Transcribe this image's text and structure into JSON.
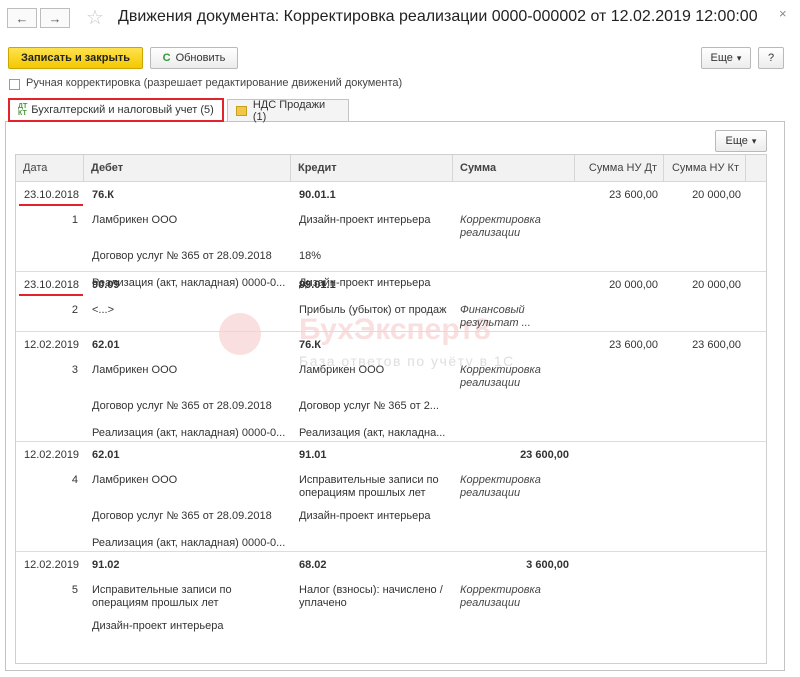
{
  "window": {
    "title": "Движения документа: Корректировка реализации 0000-000002 от 12.02.2019 12:00:00",
    "back_glyph": "←",
    "forward_glyph": "→",
    "star_glyph": "☆",
    "close_glyph": "×"
  },
  "toolbar": {
    "save_close_label": "Записать и закрыть",
    "refresh_label": "Обновить",
    "refresh_glyph": "C",
    "more_label": "Еще",
    "help_label": "?"
  },
  "manual_correction": {
    "label": "Ручная корректировка (разрешает редактирование движений документа)",
    "checked": false
  },
  "tabs": [
    {
      "label": "Бухгалтерский и налоговый учет (5)",
      "icon_top": "ДТ",
      "icon_bottom": "КТ",
      "active": true
    },
    {
      "label": "НДС Продажи (1)",
      "active": false
    }
  ],
  "grid_more_label": "Еще",
  "dropdown_glyph": "▾",
  "columns": {
    "date": "Дата",
    "debit": "Дебет",
    "credit": "Кредит",
    "amount": "Сумма",
    "nu_dt": "Сумма НУ Дт",
    "nu_kt": "Сумма НУ Кт"
  },
  "entries": [
    {
      "date": "23.10.2018",
      "num": "1",
      "debit": [
        "76.К",
        "Ламбрикен ООО",
        "Договор услуг № 365 от 28.09.2018",
        "Реализация (акт, накладная) 0000-0..."
      ],
      "credit": [
        "90.01.1",
        "Дизайн-проект интерьера",
        "18%",
        "Дизайн-проект интерьера"
      ],
      "amount": "",
      "content": [
        "Корректировка",
        "реализации"
      ],
      "nu_dt": "23 600,00",
      "nu_kt": "20 000,00"
    },
    {
      "date": "23.10.2018",
      "num": "2",
      "debit": [
        "90.09",
        "<...>"
      ],
      "credit": [
        "99.01.1",
        "Прибыль (убыток) от продаж"
      ],
      "amount": "",
      "content": [
        "Финансовый",
        "результат ..."
      ],
      "nu_dt": "20 000,00",
      "nu_kt": "20 000,00"
    },
    {
      "date": "12.02.2019",
      "num": "3",
      "debit": [
        "62.01",
        "Ламбрикен ООО",
        "Договор услуг № 365 от 28.09.2018",
        "Реализация (акт, накладная) 0000-0..."
      ],
      "credit": [
        "76.К",
        "Ламбрикен ООО",
        "Договор услуг № 365 от 2...",
        "Реализация (акт, накладна..."
      ],
      "amount": "",
      "content": [
        "Корректировка",
        "реализации"
      ],
      "nu_dt": "23 600,00",
      "nu_kt": "23 600,00"
    },
    {
      "date": "12.02.2019",
      "num": "4",
      "debit": [
        "62.01",
        "Ламбрикен ООО",
        "Договор услуг № 365 от 28.09.2018",
        "Реализация (акт, накладная) 0000-0..."
      ],
      "credit": [
        "91.01",
        "Исправительные записи по",
        "операциям прошлых лет",
        "Дизайн-проект интерьера"
      ],
      "amount": "23 600,00",
      "content": [
        "Корректировка",
        "реализации"
      ],
      "nu_dt": "",
      "nu_kt": ""
    },
    {
      "date": "12.02.2019",
      "num": "5",
      "debit": [
        "91.02",
        "Исправительные записи по",
        "операциям прошлых лет",
        "Дизайн-проект интерьера"
      ],
      "credit": [
        "68.02",
        "Налог (взносы): начислено /",
        "уплачено"
      ],
      "amount": "3 600,00",
      "content": [
        "Корректировка",
        "реализации"
      ],
      "nu_dt": "",
      "nu_kt": ""
    }
  ],
  "watermark": {
    "brand": "БухЭксперт8",
    "tagline": "База ответов по учёту в 1С"
  },
  "colors": {
    "accent_yellow": "#f3c900",
    "highlight_red": "#e3232b"
  }
}
